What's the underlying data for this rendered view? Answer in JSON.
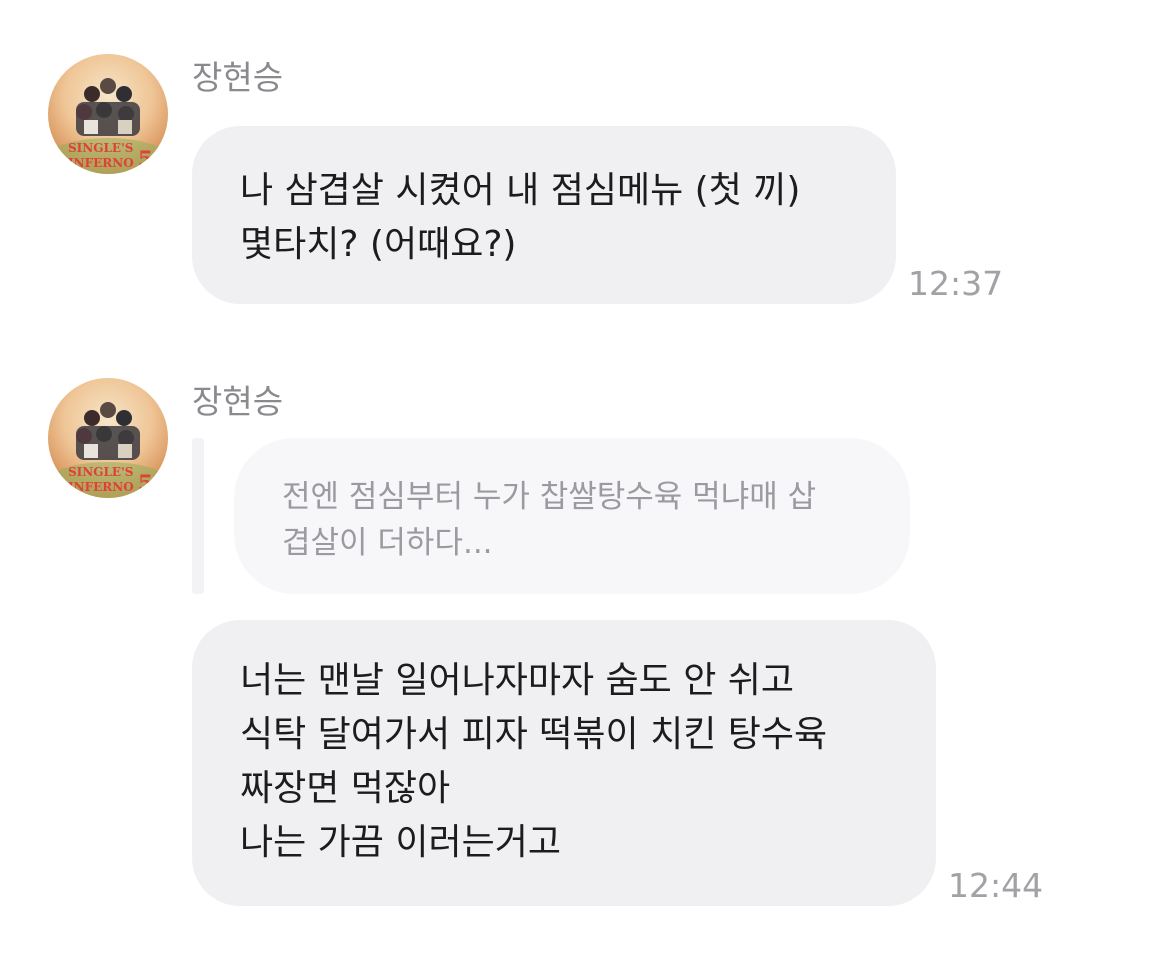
{
  "messages": [
    {
      "sender": "장현승",
      "lines": [
        "나 삼겹살 시켰어 내 점심메뉴 (첫 끼)",
        "몇타치? (어때요?)"
      ],
      "time": "12:37"
    },
    {
      "sender": "장현승",
      "reply_preview": [
        "전엔 점심부터 누가 찹쌀탕수육 먹냐매 삽",
        "겹살이 더하다..."
      ],
      "lines": [
        "너는 맨날 일어나자마자 숨도 안 쉬고",
        "식탁 달여가서 피자 떡볶이 치킨 탕수육",
        "짜장면 먹잖아",
        "나는 가끔 이러는거고"
      ],
      "time": "12:44"
    }
  ],
  "avatar": {
    "logo_text": "SINGLE'S INFERNO 5",
    "colors": {
      "top": "#f6e6c9",
      "mid": "#efc596",
      "edge": "#b86a3a",
      "logo": "#e0403a"
    }
  }
}
